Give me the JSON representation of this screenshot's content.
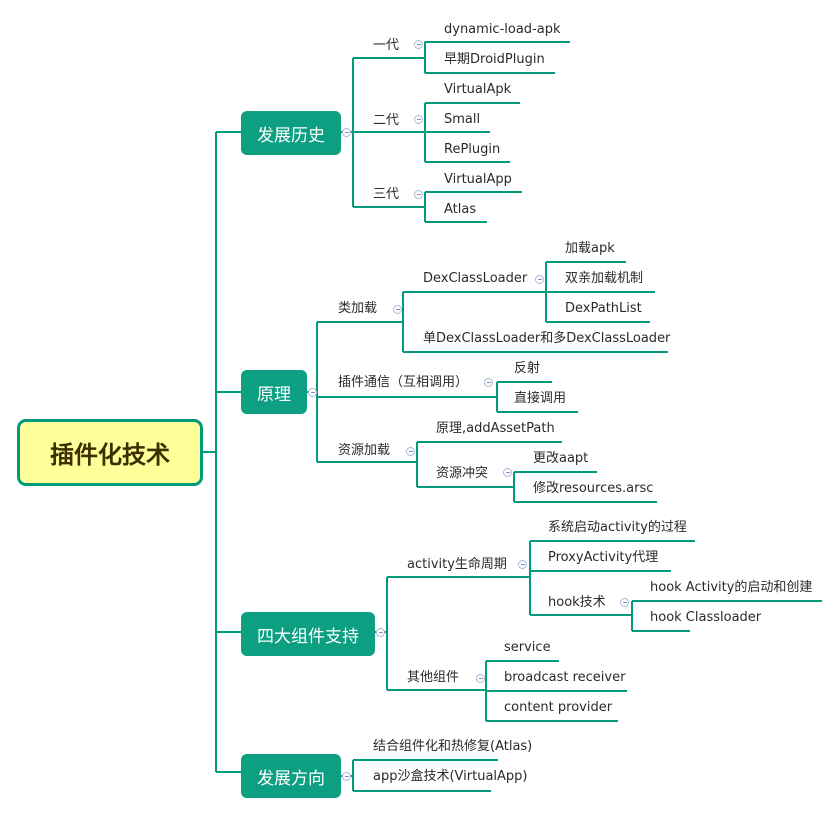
{
  "root": {
    "label": "插件化技术"
  },
  "colors": {
    "line": "#009b7d",
    "main_fill": "#0d9f82",
    "root_fill": "#ffff99",
    "root_border": "#009b7d",
    "toggle": "#a9b8d8"
  },
  "branches": {
    "history": {
      "label": "发展历史",
      "gen1": {
        "label": "一代",
        "items": [
          "dynamic-load-apk",
          "早期DroidPlugin"
        ]
      },
      "gen2": {
        "label": "二代",
        "items": [
          "VirtualApk",
          "Small",
          "RePlugin"
        ]
      },
      "gen3": {
        "label": "三代",
        "items": [
          "VirtualApp",
          "Atlas"
        ]
      }
    },
    "principle": {
      "label": "原理",
      "classload": {
        "label": "类加载",
        "dexclassloader": {
          "label": "DexClassLoader",
          "items": [
            "加载apk",
            "双亲加载机制",
            "DexPathList"
          ]
        },
        "single_multi": "单DexClassLoader和多DexClassLoader"
      },
      "comm": {
        "label": "插件通信（互相调用）",
        "items": [
          "反射",
          "直接调用"
        ]
      },
      "res": {
        "label": "资源加载",
        "principle": "原理,addAssetPath",
        "conflict": {
          "label": "资源冲突",
          "items": [
            "更改aapt",
            "修改resources.arsc"
          ]
        }
      }
    },
    "components": {
      "label": "四大组件支持",
      "activity": {
        "label": "activity生命周期",
        "items": [
          "系统启动activity的过程",
          "ProxyActivity代理"
        ],
        "hook": {
          "label": "hook技术",
          "items": [
            "hook Activity的启动和创建",
            "hook Classloader"
          ]
        }
      },
      "others": {
        "label": "其他组件",
        "items": [
          "service",
          "broadcast receiver",
          "content provider"
        ]
      }
    },
    "direction": {
      "label": "发展方向",
      "items": [
        "结合组件化和热修复(Atlas)",
        "app沙盒技术(VirtualApp)"
      ]
    }
  }
}
